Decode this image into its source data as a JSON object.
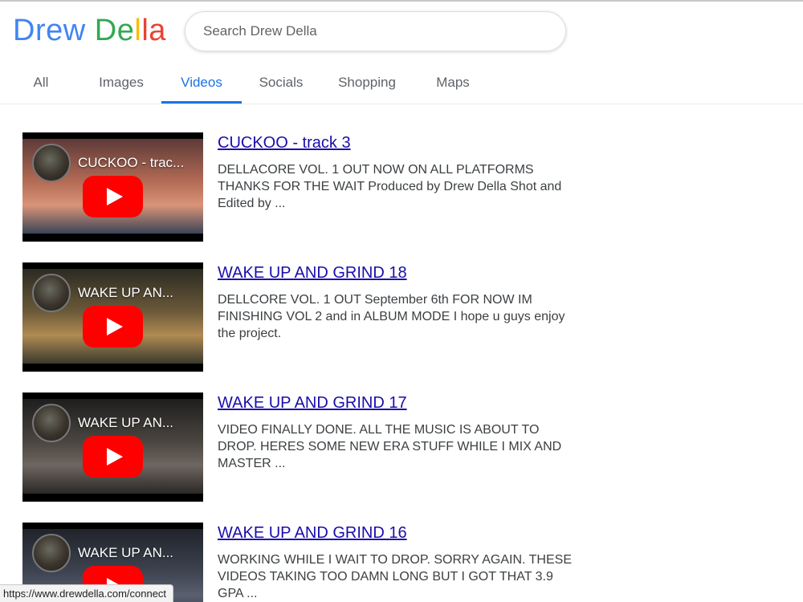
{
  "brand": {
    "letters": [
      {
        "ch": "D",
        "color": "#4285f4"
      },
      {
        "ch": "r",
        "color": "#4285f4"
      },
      {
        "ch": "e",
        "color": "#4285f4"
      },
      {
        "ch": "w",
        "color": "#4285f4"
      },
      {
        "ch": " ",
        "color": "#4285f4"
      },
      {
        "ch": "D",
        "color": "#34a853"
      },
      {
        "ch": "e",
        "color": "#34a853"
      },
      {
        "ch": "l",
        "color": "#fbbc05"
      },
      {
        "ch": "l",
        "color": "#ea4335"
      },
      {
        "ch": "a",
        "color": "#ea4335"
      }
    ]
  },
  "search": {
    "value": "",
    "placeholder": "Search Drew Della"
  },
  "tabs": [
    {
      "label": "All",
      "active": false
    },
    {
      "label": "Images",
      "active": false
    },
    {
      "label": "Videos",
      "active": true
    },
    {
      "label": "Socials",
      "active": false
    },
    {
      "label": "Shopping",
      "active": false
    },
    {
      "label": "Maps",
      "active": false
    }
  ],
  "results": [
    {
      "thumb_title": "CUCKOO - trac...",
      "thumb_colors": [
        "#5e3a38",
        "#b36b55",
        "#d99478",
        "#3b4458"
      ],
      "title": "CUCKOO - track 3",
      "description": "DELLACORE VOL. 1 OUT NOW ON ALL PLATFORMS THANKS FOR THE WAIT Produced by Drew Della Shot and Edited by ..."
    },
    {
      "thumb_title": "WAKE UP AN...",
      "thumb_colors": [
        "#2b2a22",
        "#6b5a3a",
        "#b08a52",
        "#3a3a2e"
      ],
      "title": "WAKE UP AND GRIND 18",
      "description": "DELLCORE VOL. 1 OUT September 6th FOR NOW IM FINISHING VOL 2 and in ALBUM MODE I hope u guys enjoy the project."
    },
    {
      "thumb_title": "WAKE UP AN...",
      "thumb_colors": [
        "#1e1e1e",
        "#4a4540",
        "#6e6660",
        "#2a2826"
      ],
      "title": "WAKE UP AND GRIND 17",
      "description": "VIDEO FINALLY DONE. ALL THE MUSIC IS ABOUT TO DROP. HERES SOME NEW ERA STUFF WHILE I MIX AND MASTER ..."
    },
    {
      "thumb_title": "WAKE UP AN...",
      "thumb_colors": [
        "#20232a",
        "#3e4350",
        "#5a6070",
        "#2c2f38"
      ],
      "title": "WAKE UP AND GRIND 16",
      "description": "WORKING WHILE I WAIT TO DROP. SORRY AGAIN. THESE VIDEOS TAKING TOO DAMN LONG BUT I GOT THAT 3.9 GPA ..."
    }
  ],
  "status_bar": {
    "url": "https://www.drewdella.com/connect"
  }
}
